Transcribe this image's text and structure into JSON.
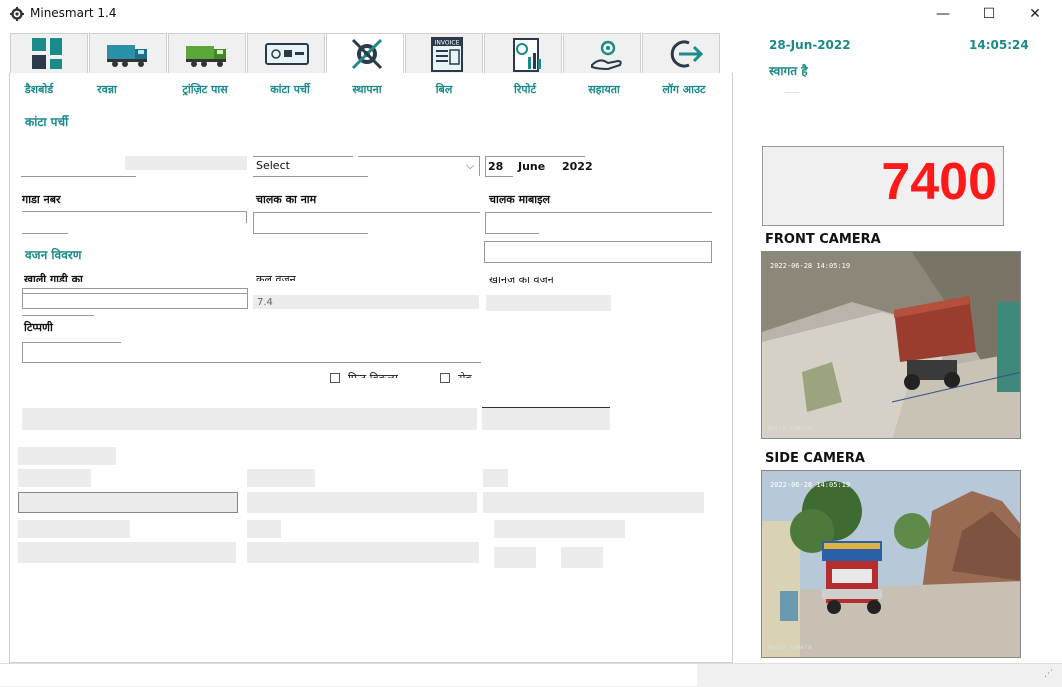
{
  "window": {
    "title": "Minesmart 1.4",
    "controls": {
      "minimize": "—",
      "maximize": "☐",
      "close": "✕"
    }
  },
  "toolbar": {
    "items": [
      {
        "label": "डैशबोर्ड",
        "icon": "dashboard-icon"
      },
      {
        "label": "रवन्ना",
        "icon": "truck-icon"
      },
      {
        "label": "ट्रांज़िट पास",
        "icon": "green-truck-icon"
      },
      {
        "label": "कांटा पर्ची",
        "icon": "ticket-icon"
      },
      {
        "label": "स्थापना",
        "icon": "settings-tools-icon",
        "active": true
      },
      {
        "label": "बिल",
        "icon": "invoice-icon",
        "icon_text": "INVOICE"
      },
      {
        "label": "रिपोर्ट",
        "icon": "report-icon"
      },
      {
        "label": "सहायता",
        "icon": "help-hand-icon"
      },
      {
        "label": "लॉग आउट",
        "icon": "logout-icon"
      }
    ]
  },
  "header": {
    "date": "28-Jun-2022",
    "time": "14:05:24",
    "welcome": "स्वागत है"
  },
  "form": {
    "section_title": "कांटा पर्ची",
    "select_placeholder": "Select",
    "date_day": "28",
    "date_month": "June",
    "date_year": "2022",
    "vehicle_label": "गाडा नबर",
    "driver_name_label": "चालक का नाम",
    "driver_mobile_label": "चालक माबाइल",
    "weight_section": "वजन विवरण",
    "empty_weight_label": "खाली गाड़ी का",
    "total_weight_label": "कुल वज़न",
    "total_weight_value": "7.4",
    "mineral_weight_label": "खनिज का वजन",
    "remark_label": "टिप्पणी",
    "checkbox1_label": "प्रिन्ट विकल्प",
    "checkbox2_label": "सेव"
  },
  "weighbridge": {
    "current_weight": "7400",
    "weight_color": "#ff1a1a"
  },
  "cameras": {
    "front_label": "FRONT CAMERA",
    "front_timestamp": "2022-06-28 14:05:19",
    "side_label": "SIDE CAMERA",
    "side_timestamp": "2022-06-28 14:05:19",
    "watermark": "Nevik Camera"
  },
  "colors": {
    "accent": "#1a8a8a"
  }
}
